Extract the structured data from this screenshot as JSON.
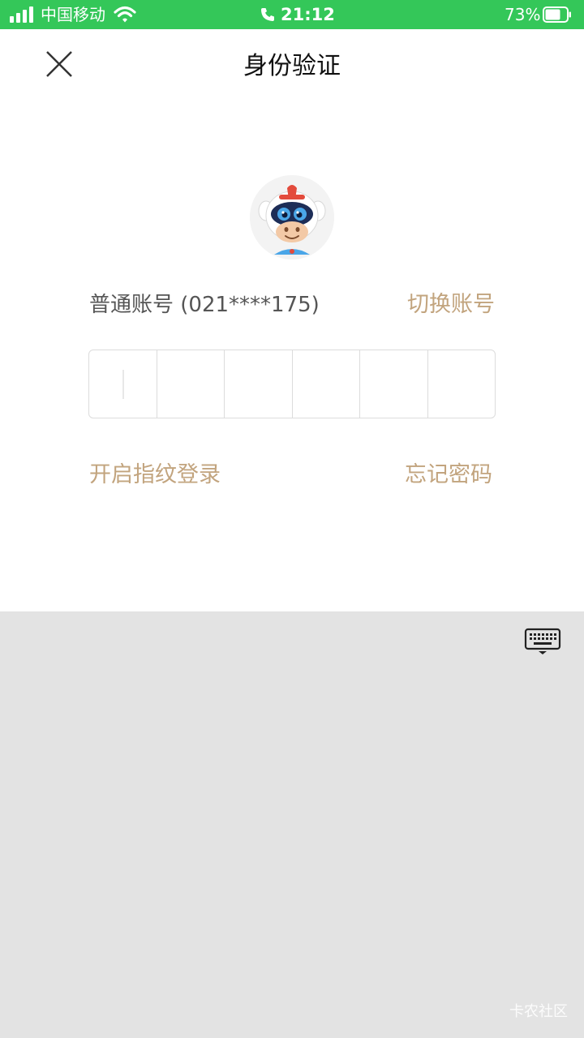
{
  "status_bar": {
    "carrier": "中国移动",
    "time": "21:12",
    "battery_percent": "73%",
    "battery_level": 0.73,
    "signal_bars": 4,
    "icons": [
      "signal-icon",
      "wifi-icon",
      "phone-icon",
      "battery-icon"
    ]
  },
  "nav": {
    "title": "身份验证",
    "close_icon": "close-icon"
  },
  "account": {
    "label": "普通账号 (021****175)",
    "switch_label": "切换账号",
    "avatar_icon": "mascot-avatar"
  },
  "password": {
    "cells": 6,
    "filled": 0
  },
  "links": {
    "fingerprint": "开启指纹登录",
    "forgot": "忘记密码"
  },
  "keyboard": {
    "toggle_icon": "keyboard-icon",
    "watermark": "卡农社区"
  },
  "colors": {
    "status_bar": "#34c759",
    "accent": "#c2a47e",
    "keyboard_bg": "#e3e3e3"
  }
}
